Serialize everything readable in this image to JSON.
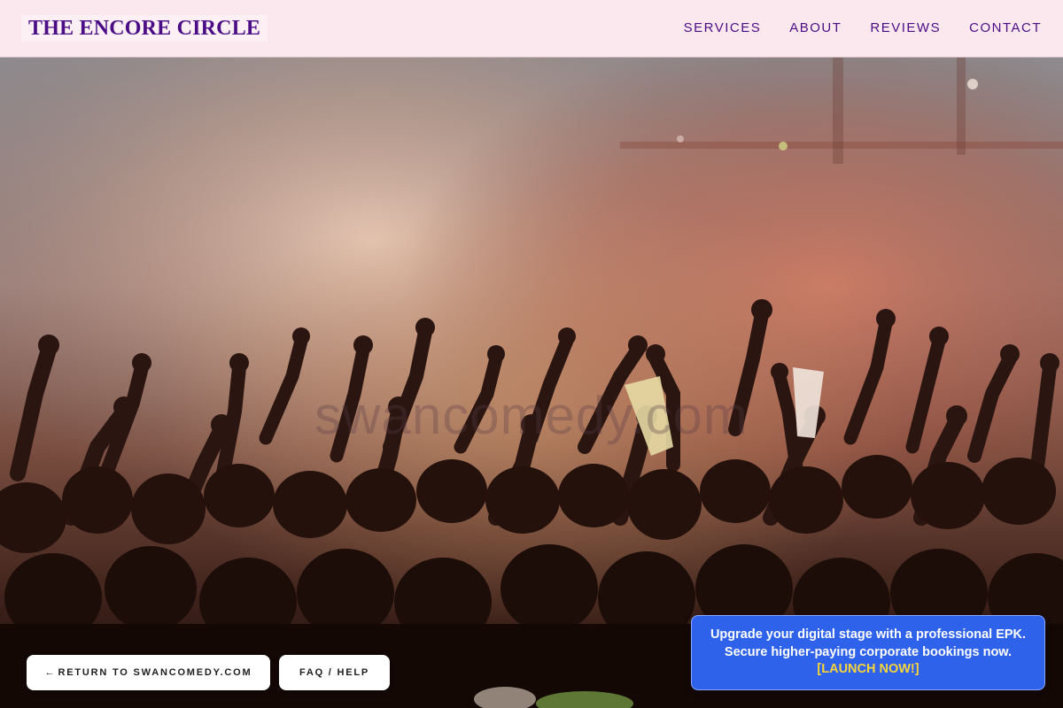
{
  "header": {
    "brand": "THE ENCORE CIRCLE",
    "nav": [
      "SERVICES",
      "ABOUT",
      "REVIEWS",
      "CONTACT"
    ]
  },
  "hero": {
    "image": "concert-crowd-hands-raised",
    "watermark": "swancomedy.com"
  },
  "buttons": {
    "return_arrow": "←",
    "return_label": "RETURN TO SWANCOMEDY.COM",
    "faq_label": "FAQ / HELP"
  },
  "promo": {
    "line1": "Upgrade your digital stage with a professional EPK.",
    "line2": "Secure higher-paying corporate bookings now.",
    "cta": "[LAUNCH NOW!]"
  },
  "colors": {
    "header_bg": "#fbe8ee",
    "brand": "#4b0d86",
    "promo_bg": "#2f62ea",
    "promo_cta": "#f6d43a"
  }
}
